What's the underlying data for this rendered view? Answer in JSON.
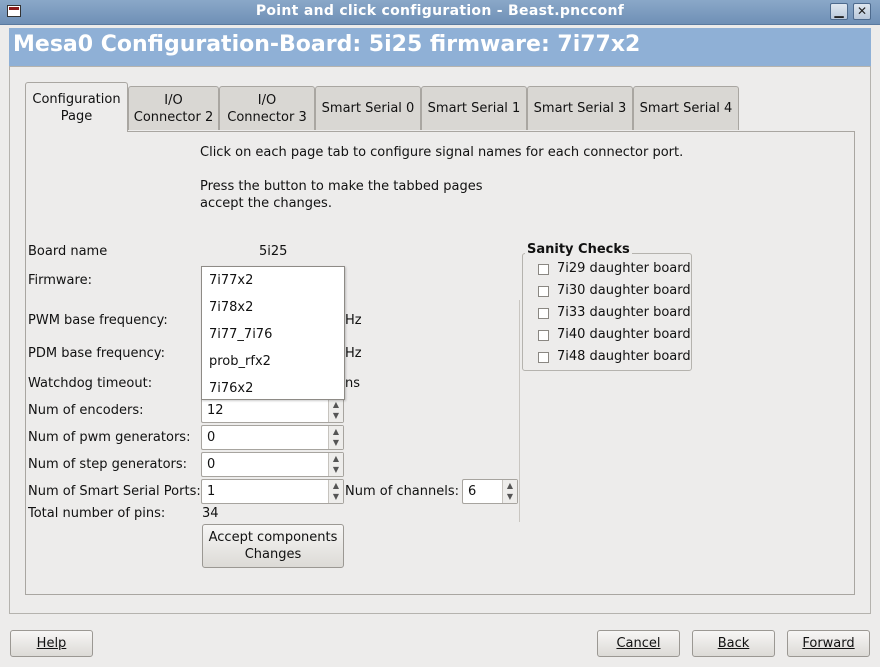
{
  "window": {
    "title": "Point and click configuration - Beast.pncconf"
  },
  "header": {
    "title": "Mesa0 Configuration-Board: 5i25 firmware: 7i77x2"
  },
  "tabs": [
    {
      "line1": "Configuration",
      "line2": "Page"
    },
    {
      "line1": "I/O",
      "line2": "Connector 2"
    },
    {
      "line1": "I/O",
      "line2": "Connector 3"
    },
    {
      "line1": "Smart Serial 0",
      "line2": ""
    },
    {
      "line1": "Smart Serial 1",
      "line2": ""
    },
    {
      "line1": "Smart Serial 3",
      "line2": ""
    },
    {
      "line1": "Smart Serial 4",
      "line2": ""
    }
  ],
  "instructions": {
    "line1": "Click on each page tab to configure signal names for each connector port.",
    "line2": "Press the button to make the tabbed pages",
    "line3": "accept the changes."
  },
  "form": {
    "board_name_label": "Board name",
    "board_name_value": "5i25",
    "firmware_label": "Firmware:",
    "pwm_label": "PWM base frequency:",
    "pwm_unit": "Hz",
    "pdm_label": "PDM base frequency:",
    "pdm_unit": "Hz",
    "watchdog_label": "Watchdog timeout:",
    "watchdog_unit": "ns",
    "encoders_label": "Num of encoders:",
    "encoders_value": "12",
    "pwmgen_label": "Num of pwm generators:",
    "pwmgen_value": "0",
    "stepgen_label": "Num of step generators:",
    "stepgen_value": "0",
    "sserial_label": "Num of Smart Serial Ports:",
    "sserial_value": "1",
    "channels_label": "Num of channels:",
    "channels_value": "6",
    "total_pins_label": "Total number of pins:",
    "total_pins_value": "34",
    "accept_line1": "Accept  components",
    "accept_line2": "Changes"
  },
  "firmware_dropdown": {
    "options": [
      "7i77x2",
      "7i78x2",
      "7i77_7i76",
      "prob_rfx2",
      "7i76x2"
    ]
  },
  "sanity": {
    "title": "Sanity Checks",
    "items": [
      {
        "label": "7i29 daughter board",
        "checked": false
      },
      {
        "label": "7i30 daughter board",
        "checked": false
      },
      {
        "label": "7i33 daughter board",
        "checked": false
      },
      {
        "label": "7i40 daughter board",
        "checked": false
      },
      {
        "label": "7i48 daughter board",
        "checked": false
      }
    ]
  },
  "buttons": {
    "help": "Help",
    "cancel": "Cancel",
    "back": "Back",
    "forward": "Forward"
  }
}
